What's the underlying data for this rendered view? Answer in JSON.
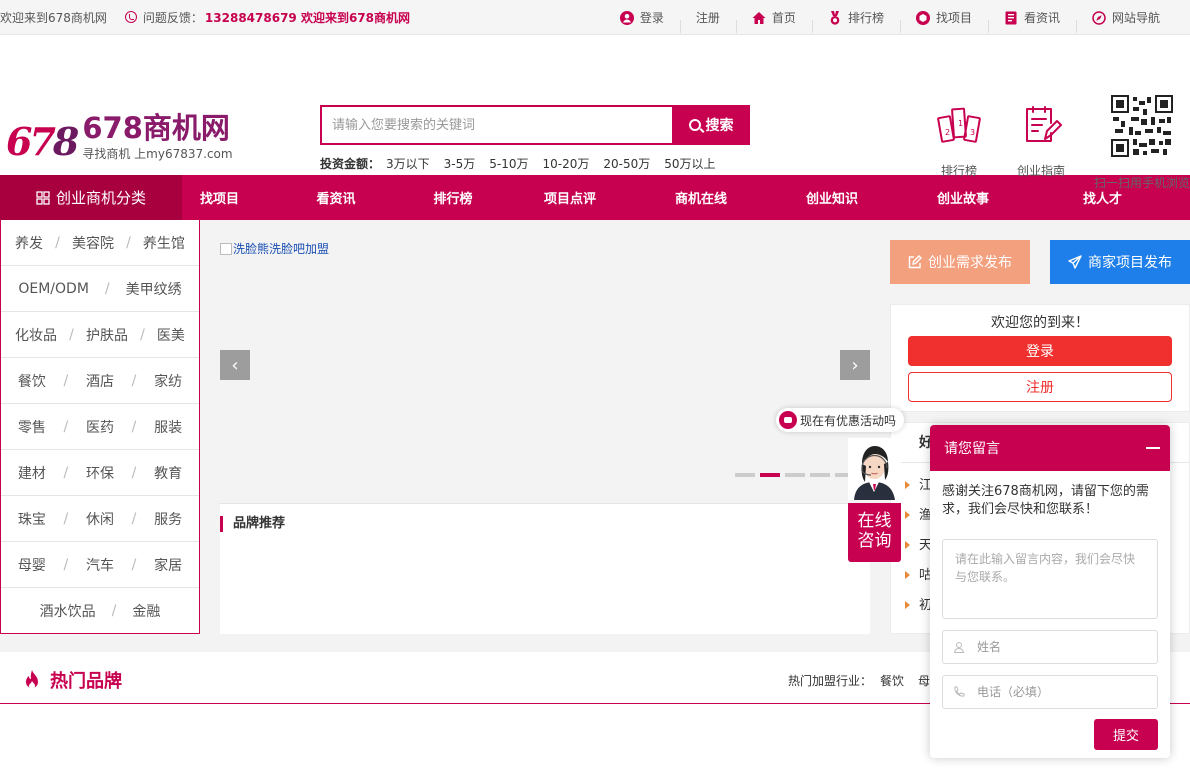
{
  "topbar": {
    "welcome": "欢迎来到678商机网",
    "feedback_label": "问题反馈：",
    "phone": "13288478679 欢迎来到678商机网",
    "links": [
      "登录",
      "注册",
      "首页",
      "排行榜",
      "找项目",
      "看资讯",
      "网站导航"
    ]
  },
  "logo": {
    "mark_a": "67",
    "mark_b": "8",
    "name": "678商机网",
    "slogan": "寻找商机 上my67837.com"
  },
  "search": {
    "placeholder": "请输入您要搜索的关键词",
    "button": "搜索",
    "amount_label": "投资金额：",
    "amounts": [
      "3万以下",
      "3-5万",
      "5-10万",
      "10-20万",
      "20-50万",
      "50万以上"
    ]
  },
  "header_right": {
    "rank_label": "排行榜",
    "guide_label": "创业指南",
    "qr_label": "扫一扫用手机浏览"
  },
  "nav": {
    "category_title": "创业商机分类",
    "links": [
      "找项目",
      "看资讯",
      "排行榜",
      "项目点评",
      "商机在线",
      "创业知识",
      "创业故事",
      "找人才"
    ]
  },
  "categories": [
    [
      "养发",
      "美容院",
      "养生馆"
    ],
    [
      "OEM/ODM",
      "美甲纹绣"
    ],
    [
      "化妆品",
      "护肤品",
      "医美"
    ],
    [
      "餐饮",
      "酒店",
      "家纺"
    ],
    [
      "零售",
      "医药",
      "服装"
    ],
    [
      "建材",
      "环保",
      "教育"
    ],
    [
      "珠宝",
      "休闲",
      "服务"
    ],
    [
      "母婴",
      "汽车",
      "家居"
    ],
    [
      "酒水饮品",
      "金融"
    ]
  ],
  "banner": {
    "alt_text": "洗脸熊洗脸吧加盟",
    "dot_count": 5,
    "active_dot": 1
  },
  "brand_rec": {
    "title": "品牌推荐"
  },
  "publish": {
    "need": "创业需求发布",
    "biz": "商家项目发布"
  },
  "login_box": {
    "welcome": "欢迎您的到来！",
    "login": "登录",
    "register": "注册"
  },
  "news": {
    "tab": "好",
    "items": [
      "江",
      "渔",
      "天",
      "咕",
      "初"
    ]
  },
  "hot": {
    "title": "热门品牌",
    "industry_label": "热门加盟行业：",
    "industries": [
      "餐饮",
      "母"
    ]
  },
  "float": {
    "promo": "现在有优惠活动吗",
    "consult_line1": "在线",
    "consult_line2": "咨询"
  },
  "message": {
    "title": "请您留言",
    "intro": "感谢关注678商机网，请留下您的需求，我们会尽快和您联系！",
    "content_placeholder": "请在此输入留言内容，我们会尽快与您联系。",
    "name_placeholder": "姓名",
    "phone_placeholder": "电话（必填）",
    "submit": "提交"
  },
  "colors": {
    "brand": "#c7004f",
    "login_red": "#f0302e",
    "need_orange": "#f3a07e",
    "biz_blue": "#1e7fea"
  }
}
